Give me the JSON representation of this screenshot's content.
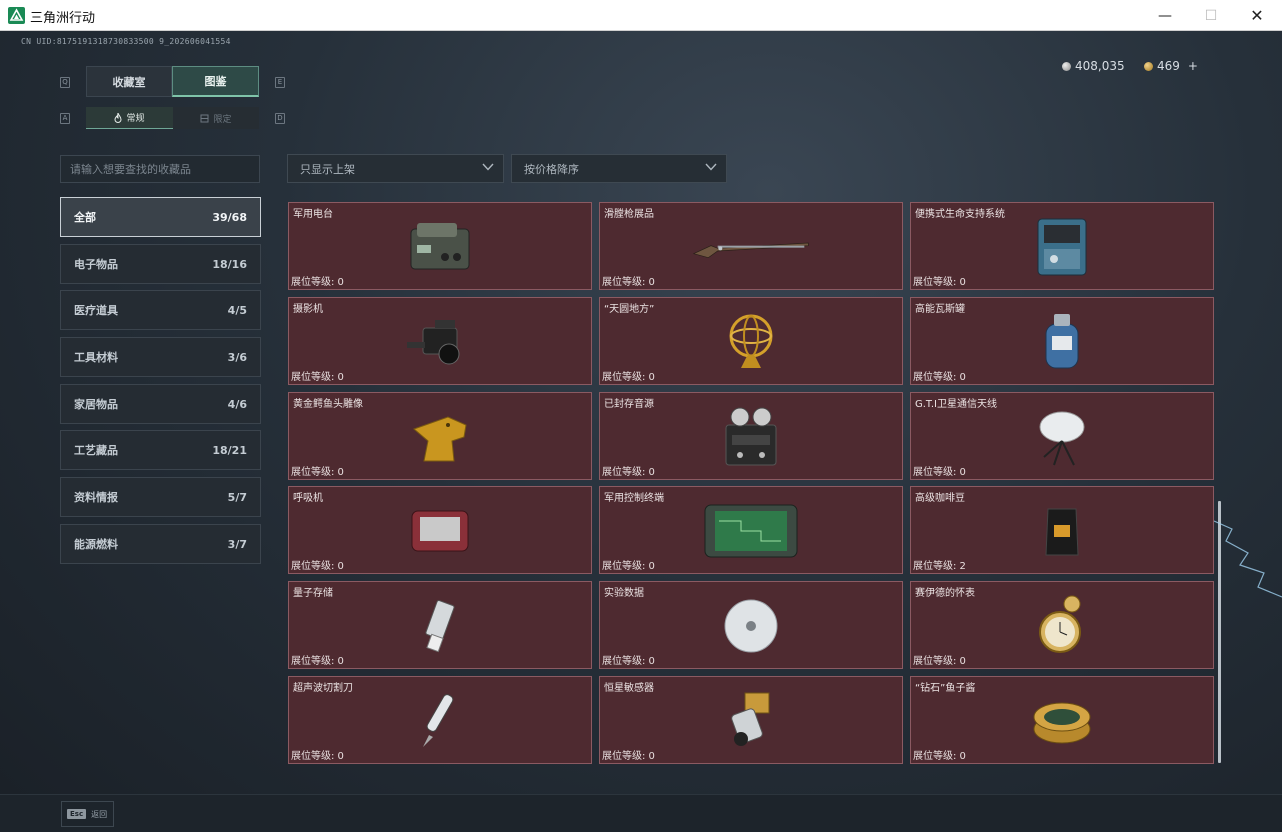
{
  "window": {
    "title": "三角洲行动",
    "minimize": "—",
    "maximize": "☐",
    "close": "✕"
  },
  "header": {
    "uid": "CN UID:8175191318730833500 9_202606041554",
    "silver": "408,035",
    "gold": "469",
    "gold_add": "+"
  },
  "tabs": {
    "prev_key": "Q",
    "next_key": "E",
    "collection": "收藏室",
    "catalog": "图鉴",
    "sub_prev_key": "A",
    "sub_next_key": "D",
    "normal": "常规",
    "limited": "限定"
  },
  "search": {
    "placeholder": "请输入想要查找的收藏品"
  },
  "filters": {
    "display": "只显示上架",
    "sort": "按价格降序"
  },
  "categories": [
    {
      "label": "全部",
      "count": "39/68"
    },
    {
      "label": "电子物品",
      "count": "18/16"
    },
    {
      "label": "医疗道具",
      "count": "4/5"
    },
    {
      "label": "工具材料",
      "count": "3/6"
    },
    {
      "label": "家居物品",
      "count": "4/6"
    },
    {
      "label": "工艺藏品",
      "count": "18/21"
    },
    {
      "label": "资料情报",
      "count": "5/7"
    },
    {
      "label": "能源燃料",
      "count": "3/7"
    }
  ],
  "items": [
    {
      "name": "军用电台",
      "level": "展位等级:  0",
      "icon": "radio-icon"
    },
    {
      "name": "滑膛枪展品",
      "level": "展位等级:  0",
      "icon": "musket-icon"
    },
    {
      "name": "便携式生命支持系统",
      "level": "展位等级:  0",
      "icon": "life-support-icon"
    },
    {
      "name": "摄影机",
      "level": "展位等级:  0",
      "icon": "camera-icon"
    },
    {
      "name": "“天圆地方”",
      "level": "展位等级:  0",
      "icon": "armillary-sphere-icon"
    },
    {
      "name": "高能瓦斯罐",
      "level": "展位等级:  0",
      "icon": "gas-canister-icon"
    },
    {
      "name": "黄金鳄鱼头雕像",
      "level": "展位等级:  0",
      "icon": "gold-crocodile-icon"
    },
    {
      "name": "已封存音源",
      "level": "展位等级:  0",
      "icon": "reel-recorder-icon"
    },
    {
      "name": "G.T.I卫星通信天线",
      "level": "展位等级:  0",
      "icon": "satellite-dish-icon"
    },
    {
      "name": "呼吸机",
      "level": "展位等级:  0",
      "icon": "ventilator-icon"
    },
    {
      "name": "军用控制终端",
      "level": "展位等级:  0",
      "icon": "control-terminal-icon"
    },
    {
      "name": "高级咖啡豆",
      "level": "展位等级:  2",
      "icon": "coffee-bag-icon"
    },
    {
      "name": "量子存储",
      "level": "展位等级:  0",
      "icon": "usb-drive-icon"
    },
    {
      "name": "实验数据",
      "level": "展位等级:  0",
      "icon": "disc-icon"
    },
    {
      "name": "赛伊德的怀表",
      "level": "展位等级:  0",
      "icon": "pocket-watch-icon"
    },
    {
      "name": "超声波切割刀",
      "level": "展位等级:  0",
      "icon": "ultrasonic-cutter-icon"
    },
    {
      "name": "恒星敏感器",
      "level": "展位等级:  0",
      "icon": "star-sensor-icon"
    },
    {
      "name": "“钻石”鱼子酱",
      "level": "展位等级:  0",
      "icon": "caviar-tin-icon"
    }
  ],
  "footer": {
    "esc_key": "Esc",
    "esc_label": "返回"
  },
  "colors": {
    "accent": "#7fc4a9",
    "card_bg": "#4e2a30",
    "card_border": "#8b5a62"
  }
}
